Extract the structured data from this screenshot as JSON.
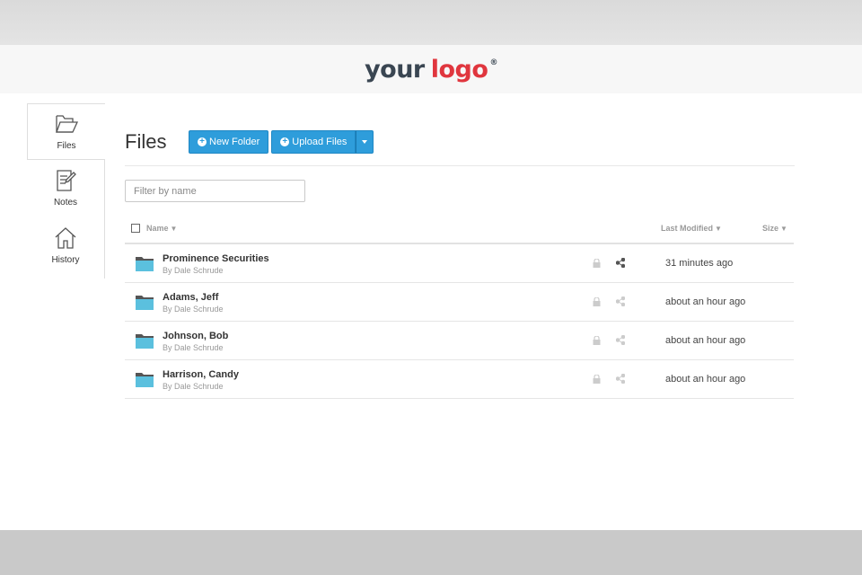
{
  "brand": {
    "logo_word1": "your",
    "logo_word2": "logo",
    "logo_mark": "®",
    "accent": "#2e9ddb",
    "logo_red": "#e0363e"
  },
  "sidebar": {
    "items": [
      {
        "label": "Files",
        "icon": "folder-icon",
        "active": true
      },
      {
        "label": "Notes",
        "icon": "notes-icon",
        "active": false
      },
      {
        "label": "History",
        "icon": "home-icon",
        "active": false
      }
    ]
  },
  "main": {
    "title": "Files",
    "new_folder_label": "New Folder",
    "upload_label": "Upload Files",
    "filter_placeholder": "Filter by name",
    "columns": {
      "name": "Name",
      "modified": "Last Modified",
      "size": "Size"
    },
    "rows": [
      {
        "name": "Prominence Securities",
        "by": "By Dale Schrude",
        "modified": "31 minutes ago",
        "shared": true
      },
      {
        "name": "Adams, Jeff",
        "by": "By Dale Schrude",
        "modified": "about an hour ago",
        "shared": false
      },
      {
        "name": "Johnson, Bob",
        "by": "By Dale Schrude",
        "modified": "about an hour ago",
        "shared": false
      },
      {
        "name": "Harrison, Candy",
        "by": "By Dale Schrude",
        "modified": "about an hour ago",
        "shared": false
      }
    ]
  }
}
